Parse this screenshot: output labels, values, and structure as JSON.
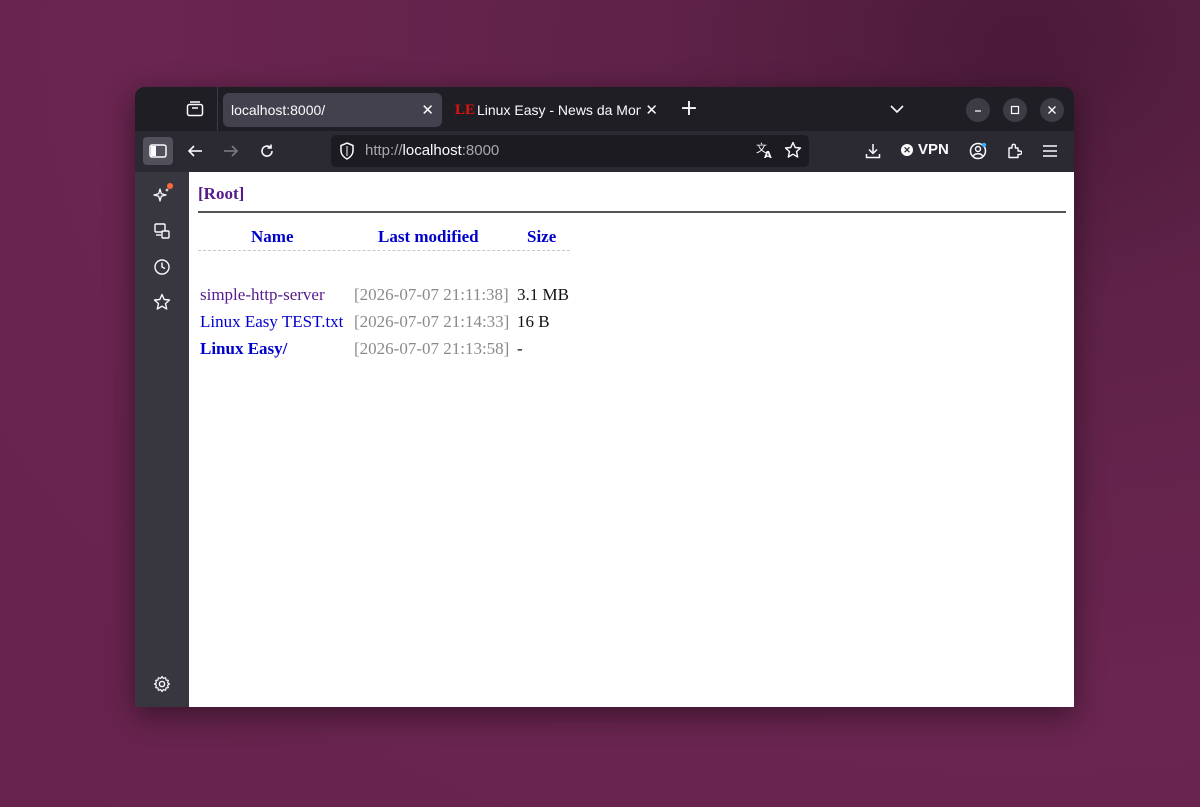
{
  "browser": {
    "tabs": [
      {
        "title": "localhost:8000/",
        "active": true
      },
      {
        "title": "Linux Easy - News da Mon",
        "favicon": "LE",
        "active": false
      }
    ],
    "url_scheme": "http://",
    "url_host": "localhost",
    "url_port": ":8000",
    "vpn_label": "VPN",
    "accent": "#ff6a3d"
  },
  "page": {
    "root_label": "[Root]",
    "headers": {
      "name": "Name",
      "modified": "Last modified",
      "size": "Size"
    },
    "rows": [
      {
        "name": "simple-http-server",
        "modified": "[2026-07-07 21:11:38]",
        "size": "3.1 MB"
      },
      {
        "name": "Linux Easy TEST.txt",
        "modified": "[2026-07-07 21:14:33]",
        "size": "16 B"
      },
      {
        "name": "Linux Easy/",
        "modified": "[2026-07-07 21:13:58]",
        "size": "-"
      }
    ]
  }
}
